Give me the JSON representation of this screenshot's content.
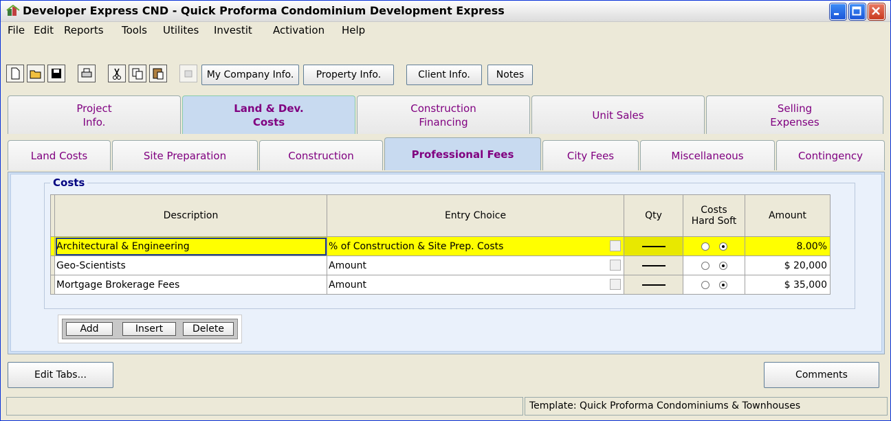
{
  "window": {
    "title": "Developer Express  CND - Quick Proforma Condominium Development  Express",
    "icon": "app-icon"
  },
  "menu": {
    "items": [
      "File",
      "Edit",
      "Reports",
      "Tools",
      "Utilites",
      "Investit",
      "Activation",
      "Help"
    ]
  },
  "toolbar": {
    "icons": [
      "new-file-icon",
      "open-folder-icon",
      "save-icon",
      "print-icon",
      "cut-icon",
      "copy-icon",
      "paste-icon",
      "disabled-icon"
    ],
    "buttons": [
      "My Company Info.",
      "Property Info.",
      "Client Info.",
      "Notes"
    ]
  },
  "main_tabs": [
    {
      "line1": "Project",
      "line2": "Info.",
      "active": false
    },
    {
      "line1": "Land & Dev.",
      "line2": "Costs",
      "active": true
    },
    {
      "line1": "Construction",
      "line2": "Financing",
      "active": false
    },
    {
      "line1": "Unit Sales",
      "line2": "",
      "active": false
    },
    {
      "line1": "Selling",
      "line2": "Expenses",
      "active": false
    }
  ],
  "sub_tabs": [
    {
      "label": "Land Costs",
      "active": false
    },
    {
      "label": "Site Preparation",
      "active": false
    },
    {
      "label": "Construction",
      "active": false
    },
    {
      "label": "Professional Fees",
      "active": true
    },
    {
      "label": "City Fees",
      "active": false
    },
    {
      "label": "Miscellaneous",
      "active": false
    },
    {
      "label": "Contingency",
      "active": false
    }
  ],
  "costs": {
    "legend": "Costs",
    "columns": {
      "description": "Description",
      "entry_choice": "Entry Choice",
      "qty": "Qty",
      "costs_line1": "Costs",
      "costs_line2": "Hard Soft",
      "amount": "Amount"
    },
    "rows": [
      {
        "description": "Architectural & Engineering",
        "entry_choice": "% of Construction & Site Prep. Costs",
        "hard": false,
        "soft": true,
        "amount": "8.00%",
        "selected": true
      },
      {
        "description": "Geo-Scientists",
        "entry_choice": "Amount",
        "hard": false,
        "soft": true,
        "amount": "$ 20,000",
        "selected": false
      },
      {
        "description": "Mortgage Brokerage Fees",
        "entry_choice": "Amount",
        "hard": false,
        "soft": true,
        "amount": "$ 35,000",
        "selected": false
      }
    ]
  },
  "row_buttons": {
    "add": "Add",
    "insert": "Insert",
    "delete": "Delete"
  },
  "bottom": {
    "edit_tabs": "Edit Tabs...",
    "comments": "Comments"
  },
  "status": {
    "left": "",
    "template": "Template: Quick Proforma Condominiums & Townhouses"
  },
  "colors": {
    "selected_row": "#ffff00",
    "tab_text": "#800080",
    "legend": "#000080",
    "active_tab": "#c8daf0"
  }
}
